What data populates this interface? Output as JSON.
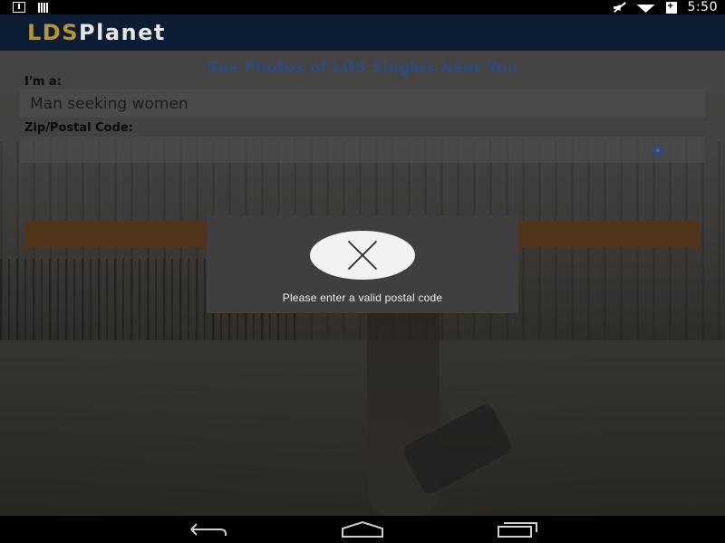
{
  "status_bar": {
    "time": "5:50",
    "icons": [
      "download-icon",
      "signal-bars-icon",
      "mute-icon",
      "wifi-icon",
      "battery-charging-icon"
    ]
  },
  "app_bar": {
    "logo_part1": "LDS",
    "logo_part2": "Planet",
    "logo_colors": {
      "part1": "#b8952e",
      "part2": "#e6e6e6"
    }
  },
  "form": {
    "headline": "See Photos of LDS Singles Near You",
    "seeking_label": "I'm a:",
    "seeking_value": "Man seeking women",
    "zip_label": "Zip/Postal Code:",
    "zip_value": "",
    "location_icon": "location-pin-icon",
    "submit_color": "#51351a"
  },
  "dialog": {
    "icon": "error-x-icon",
    "message": "Please enter a valid postal code"
  },
  "nav_bar": {
    "buttons": [
      "back-icon",
      "home-icon",
      "recent-apps-icon"
    ]
  },
  "colors": {
    "app_bar": "#0b1c33",
    "headline": "#2c4b7d",
    "dialog": "#3f3f3f"
  }
}
